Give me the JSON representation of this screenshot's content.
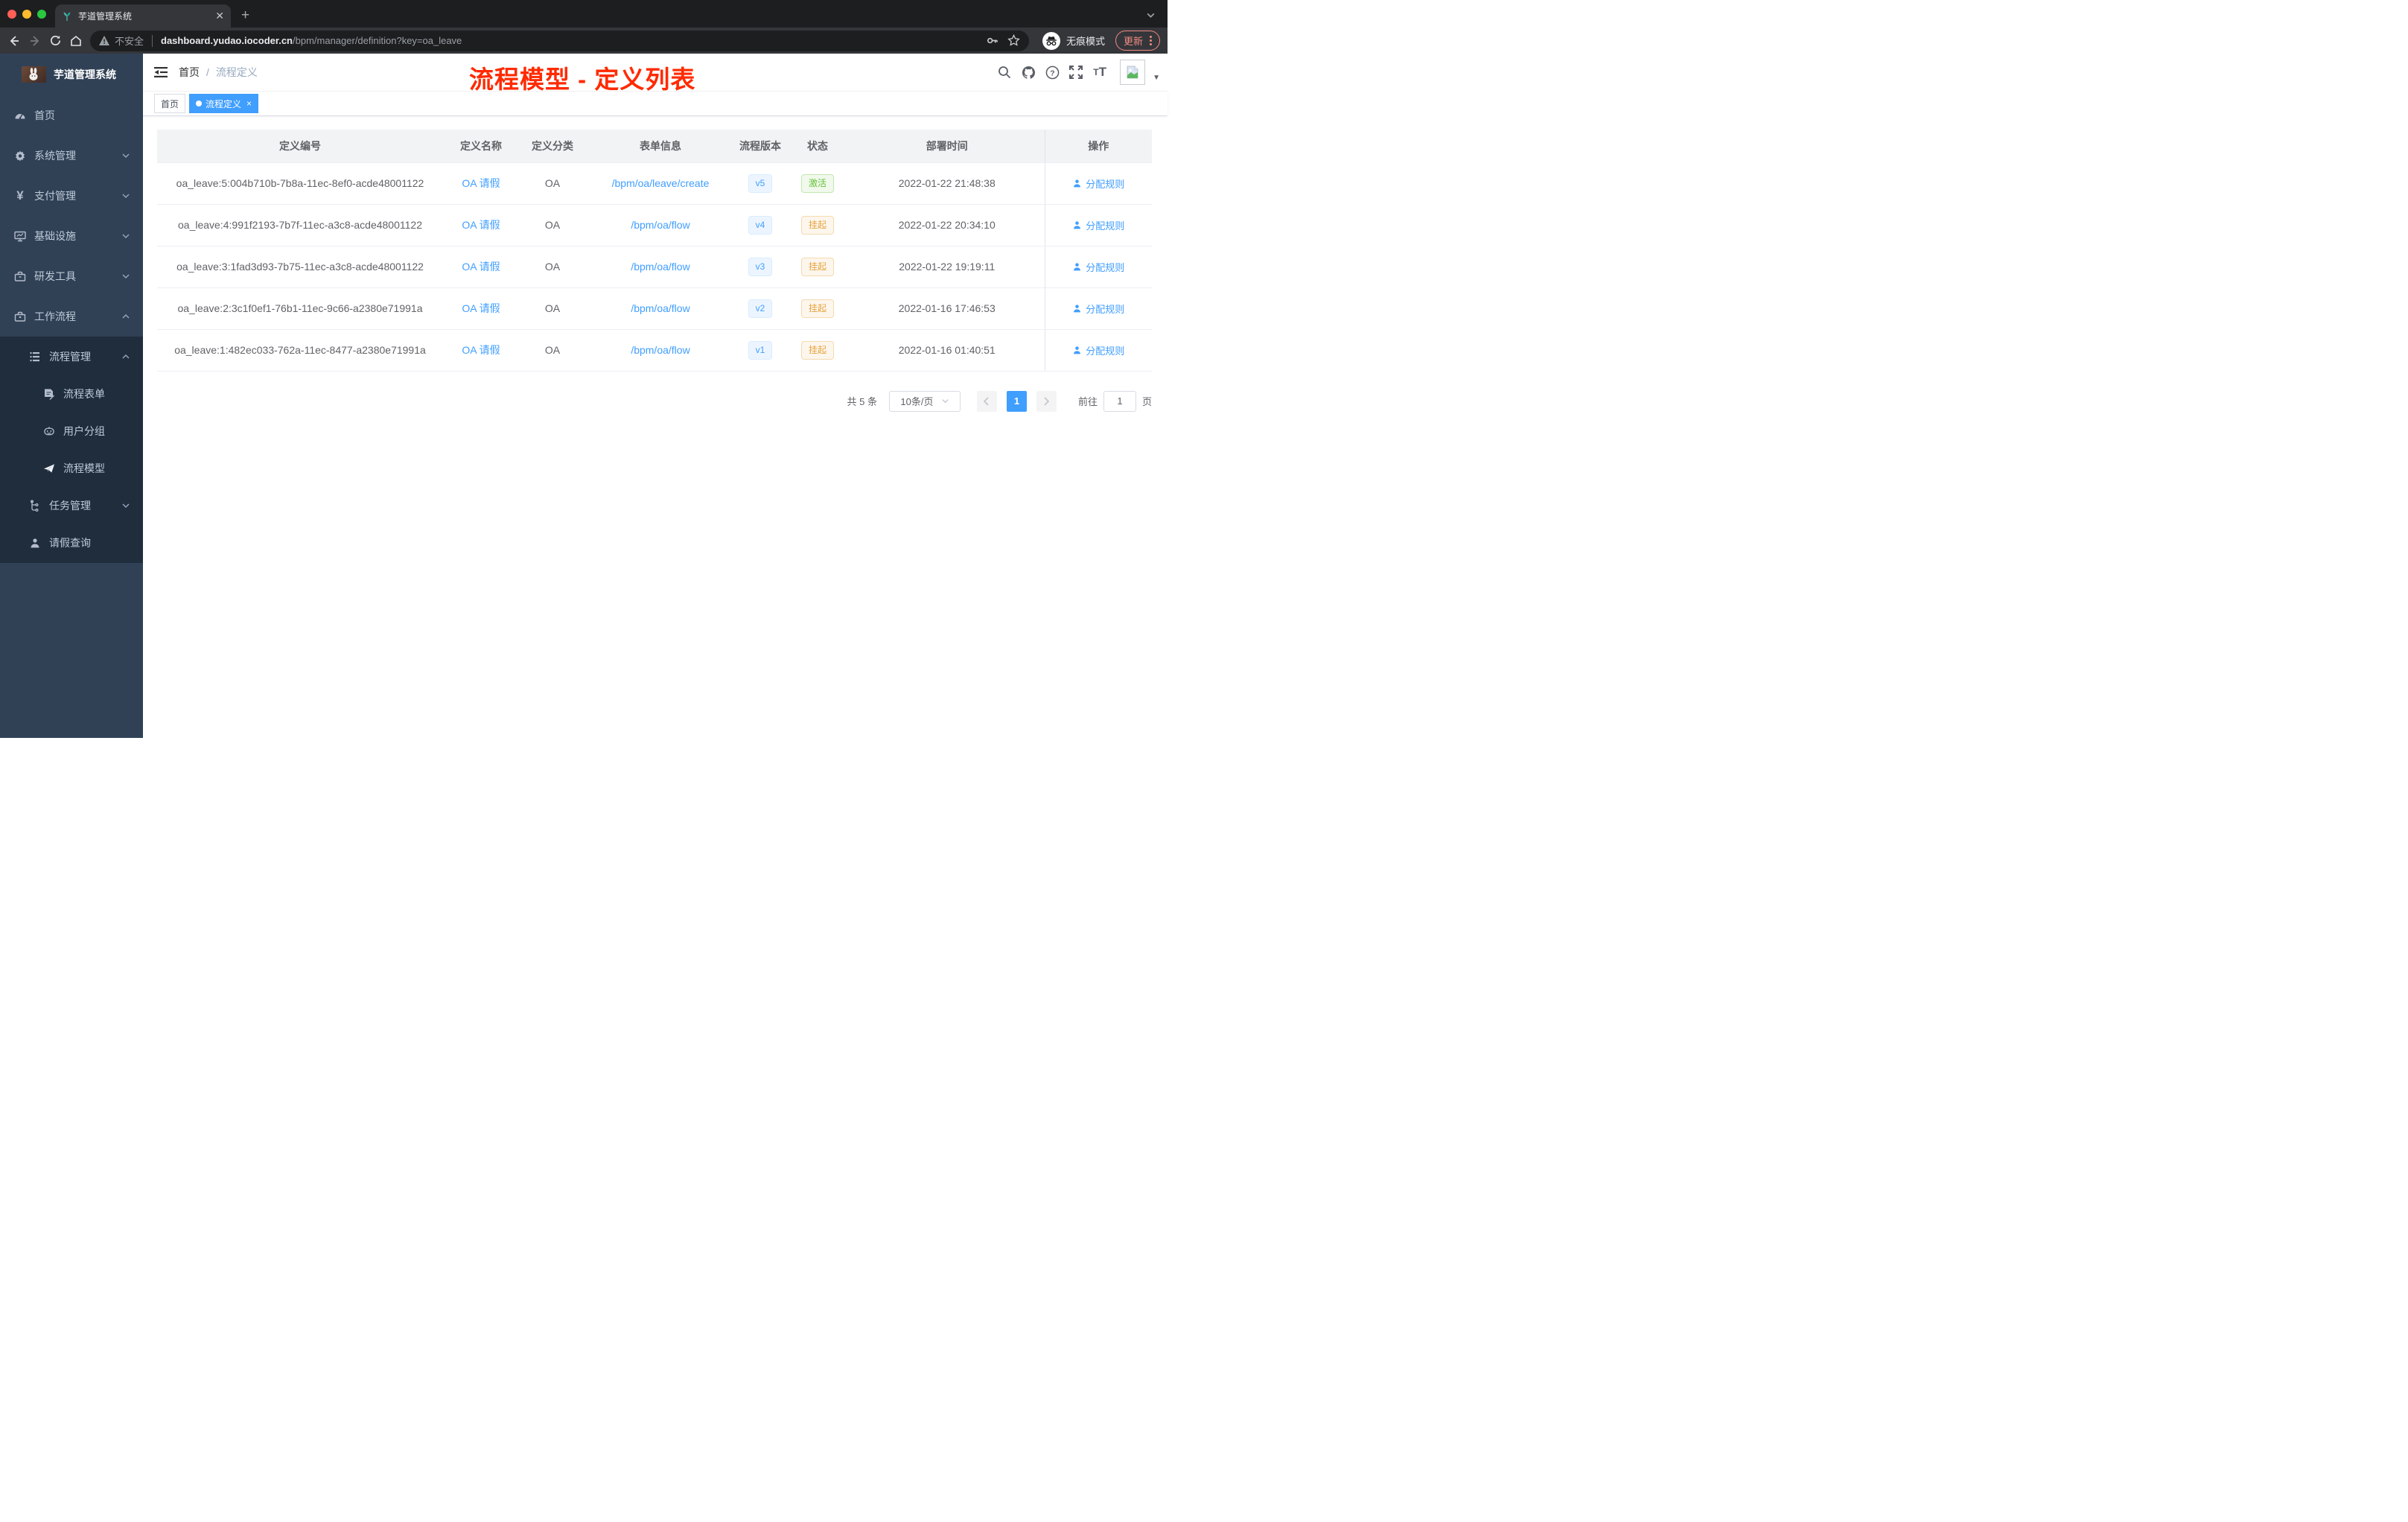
{
  "browser": {
    "tab_title": "芋道管理系统",
    "security_label": "不安全",
    "url_host": "dashboard.yudao.iocoder.cn",
    "url_path": "/bpm/manager/definition?key=oa_leave",
    "incognito_label": "无痕模式",
    "update_label": "更新"
  },
  "overlay_title": "流程模型 - 定义列表",
  "sidebar": {
    "app_title": "芋道管理系统",
    "items": [
      {
        "label": "首页"
      },
      {
        "label": "系统管理"
      },
      {
        "label": "支付管理"
      },
      {
        "label": "基础设施"
      },
      {
        "label": "研发工具"
      },
      {
        "label": "工作流程"
      },
      {
        "label": "流程管理"
      },
      {
        "label": "流程表单"
      },
      {
        "label": "用户分组"
      },
      {
        "label": "流程模型"
      },
      {
        "label": "任务管理"
      },
      {
        "label": "请假查询"
      }
    ]
  },
  "navbar": {
    "breadcrumb_home": "首页",
    "breadcrumb_separator": "/",
    "breadcrumb_current": "流程定义"
  },
  "tags": {
    "home": "首页",
    "active": "流程定义"
  },
  "table": {
    "headers": [
      "定义编号",
      "定义名称",
      "定义分类",
      "表单信息",
      "流程版本",
      "状态",
      "部署时间",
      "操作"
    ],
    "rows": [
      {
        "id": "oa_leave:5:004b710b-7b8a-11ec-8ef0-acde48001122",
        "name": "OA 请假",
        "category": "OA",
        "form": "/bpm/oa/leave/create",
        "version": "v5",
        "status": "激活",
        "status_type": "success",
        "deploy_time": "2022-01-22 21:48:38",
        "action": "分配规则"
      },
      {
        "id": "oa_leave:4:991f2193-7b7f-11ec-a3c8-acde48001122",
        "name": "OA 请假",
        "category": "OA",
        "form": "/bpm/oa/flow",
        "version": "v4",
        "status": "挂起",
        "status_type": "warning",
        "deploy_time": "2022-01-22 20:34:10",
        "action": "分配规则"
      },
      {
        "id": "oa_leave:3:1fad3d93-7b75-11ec-a3c8-acde48001122",
        "name": "OA 请假",
        "category": "OA",
        "form": "/bpm/oa/flow",
        "version": "v3",
        "status": "挂起",
        "status_type": "warning",
        "deploy_time": "2022-01-22 19:19:11",
        "action": "分配规则"
      },
      {
        "id": "oa_leave:2:3c1f0ef1-76b1-11ec-9c66-a2380e71991a",
        "name": "OA 请假",
        "category": "OA",
        "form": "/bpm/oa/flow",
        "version": "v2",
        "status": "挂起",
        "status_type": "warning",
        "deploy_time": "2022-01-16 17:46:53",
        "action": "分配规则"
      },
      {
        "id": "oa_leave:1:482ec033-762a-11ec-8477-a2380e71991a",
        "name": "OA 请假",
        "category": "OA",
        "form": "/bpm/oa/flow",
        "version": "v1",
        "status": "挂起",
        "status_type": "warning",
        "deploy_time": "2022-01-16 01:40:51",
        "action": "分配规则"
      }
    ]
  },
  "pagination": {
    "total_text": "共 5 条",
    "page_size": "10条/页",
    "current_page": "1",
    "goto_label": "前往",
    "goto_value": "1",
    "page_unit": "页"
  },
  "colors": {
    "accent_blue": "#409eff",
    "success_green": "#67c23a",
    "warning_orange": "#e6a23c",
    "sidebar_bg": "#304156",
    "submenu_bg": "#1f2d3d",
    "overlay_red": "#ff2a00"
  }
}
